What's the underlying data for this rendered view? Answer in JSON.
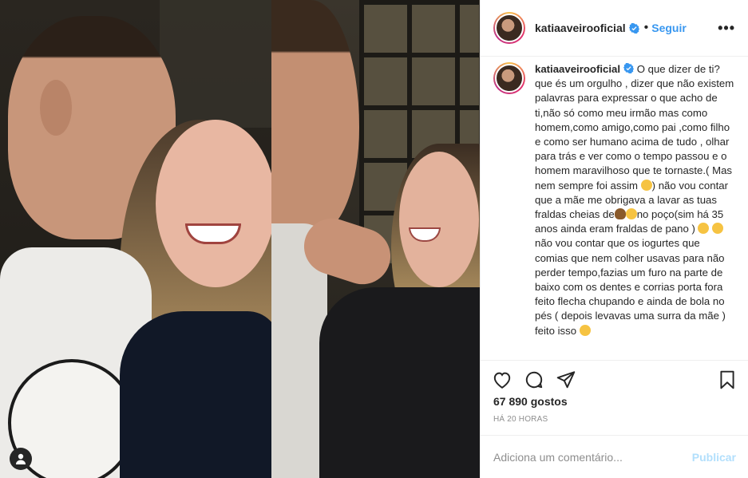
{
  "post": {
    "username": "katiaaveirooficial",
    "follow_label": "Seguir",
    "more_label": "•••",
    "likes": "67 890 gostos",
    "time_ago": "HÁ 20 HORAS",
    "comment_placeholder": "Adiciona um comentário...",
    "publish_label": "Publicar"
  },
  "caption": {
    "username": "katiaaveirooficial",
    "part1": "O que dizer de ti? que és um orgulho , dizer que não existem palavras para expressar o que acho de ti,não só como meu irmão mas como homem,como amigo,como pai ,como filho e como ser humano acima de tudo , olhar para trás e ver como o tempo passou e o homem maravilhoso que te tornaste.( Mas nem sempre foi assim ",
    "part2": ") não vou contar que a mãe me obrigava a lavar as tuas fraldas cheias de",
    "part3": "no poço(sim há 35 anos ainda eram fraldas de pano )",
    "part4": "não vou contar que os iogurtes que comias que nem colher usavas para não perder tempo,fazias um furo na parte de baixo com os dentes e corrias porta fora feito flecha chupando e ainda de bola no pés ( depois levavas uma surra da mãe ) feito isso ",
    "emoji_colors": {
      "face": "#f6c342",
      "poop": "#8a5a2b"
    }
  },
  "colors": {
    "verified": "#3897f0",
    "follow": "#3897f0",
    "publish_disabled": "#b2dffc"
  },
  "icons": [
    "heart-icon",
    "comment-icon",
    "share-icon",
    "bookmark-icon",
    "verified-icon",
    "user-tag-icon",
    "more-icon"
  ]
}
